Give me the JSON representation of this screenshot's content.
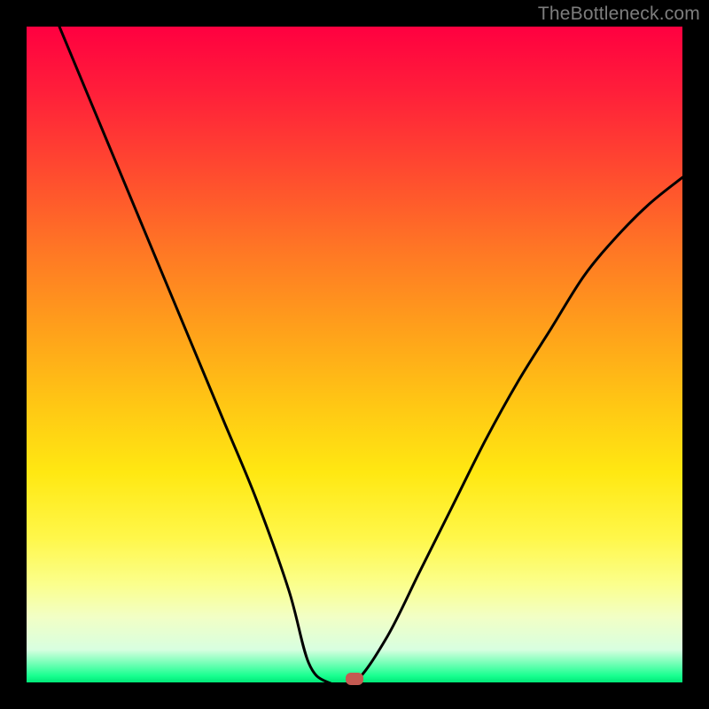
{
  "watermark": "TheBottleneck.com",
  "chart_data": {
    "type": "line",
    "title": "",
    "xlabel": "",
    "ylabel": "",
    "xlim": [
      0,
      1
    ],
    "ylim": [
      0,
      1
    ],
    "background_gradient": {
      "top_color": "#ff0040",
      "mid_color": "#ffe812",
      "bottom_color": "#00e878"
    },
    "series": [
      {
        "name": "bottleneck-curve",
        "x": [
          0.05,
          0.1,
          0.15,
          0.2,
          0.25,
          0.3,
          0.35,
          0.4,
          0.43,
          0.46,
          0.5,
          0.55,
          0.6,
          0.65,
          0.7,
          0.75,
          0.8,
          0.85,
          0.9,
          0.95,
          1.0
        ],
        "y": [
          1.0,
          0.88,
          0.76,
          0.64,
          0.52,
          0.4,
          0.28,
          0.14,
          0.03,
          0.0,
          0.0,
          0.07,
          0.17,
          0.27,
          0.37,
          0.46,
          0.54,
          0.62,
          0.68,
          0.73,
          0.77
        ]
      }
    ],
    "marker": {
      "name": "optimal-point",
      "x": 0.5,
      "y": 0.0,
      "color": "#c45a52"
    }
  }
}
